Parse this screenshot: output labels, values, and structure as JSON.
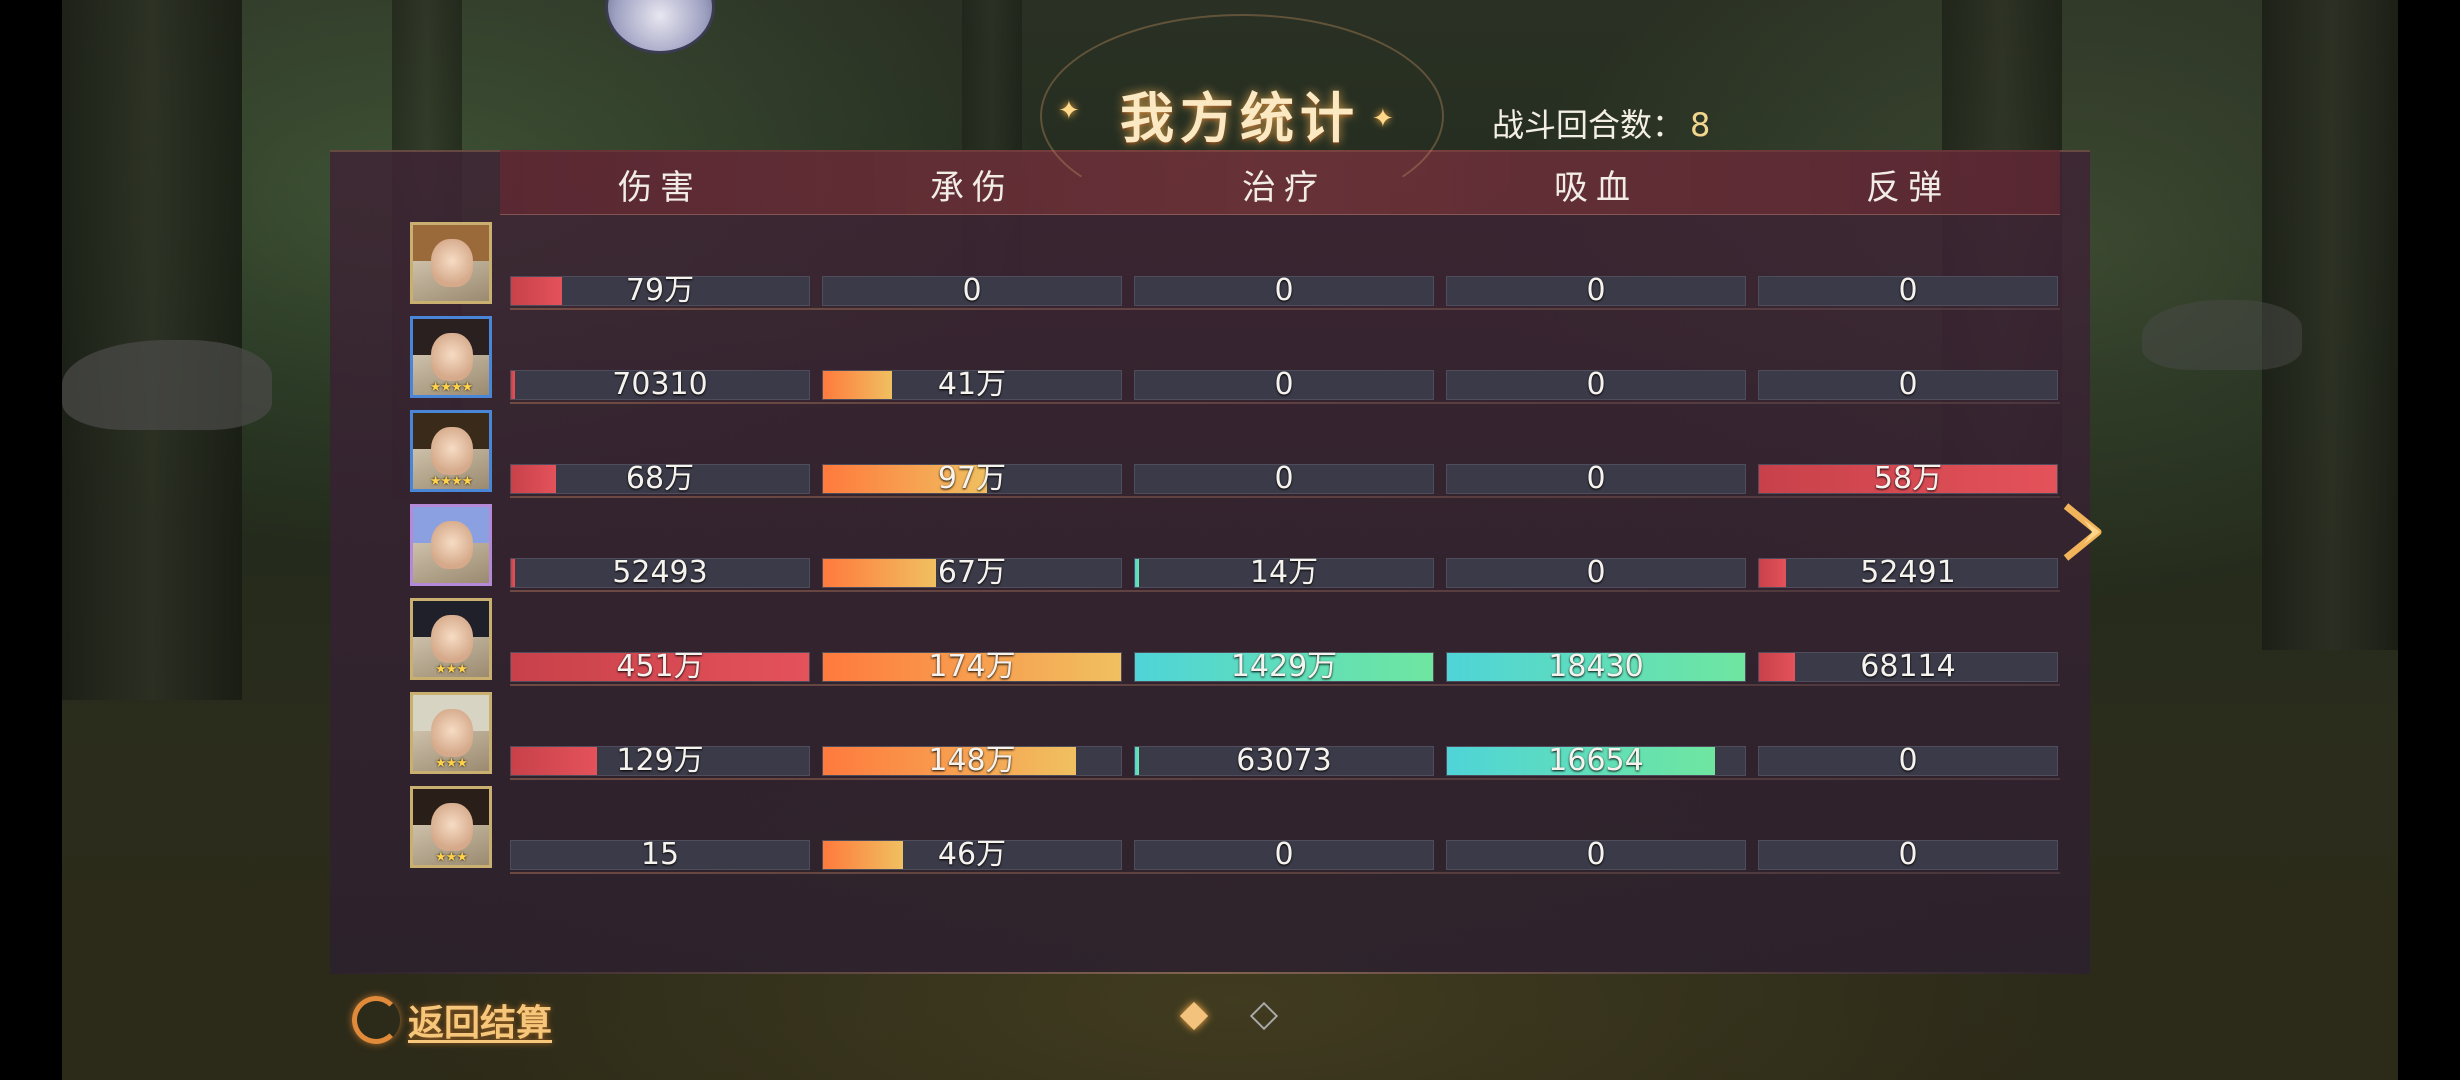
{
  "title": "我方统计",
  "rounds_label": "战斗回合数：",
  "rounds_value": "8",
  "columns": [
    "伤害",
    "承伤",
    "治疗",
    "吸血",
    "反弹"
  ],
  "bar_colors": {
    "damage": "#d4434c",
    "taken": "#ff8a3d",
    "heal": "#4fd4d8",
    "lifesteal": "#4fd4d8",
    "reflect": "#d4434c"
  },
  "rows": [
    {
      "hero": "hero-1",
      "stars": "",
      "frame": "#c9b070",
      "cells": [
        {
          "text": "79万",
          "fill": 0.17
        },
        {
          "text": "0",
          "fill": 0
        },
        {
          "text": "0",
          "fill": 0
        },
        {
          "text": "0",
          "fill": 0
        },
        {
          "text": "0",
          "fill": 0
        }
      ]
    },
    {
      "hero": "hero-2",
      "stars": "★★★★",
      "frame": "#4a86d8",
      "cells": [
        {
          "text": "70310",
          "fill": 0.015
        },
        {
          "text": "41万",
          "fill": 0.23
        },
        {
          "text": "0",
          "fill": 0
        },
        {
          "text": "0",
          "fill": 0
        },
        {
          "text": "0",
          "fill": 0
        }
      ]
    },
    {
      "hero": "hero-3",
      "stars": "★★★★",
      "frame": "#4a86d8",
      "cells": [
        {
          "text": "68万",
          "fill": 0.15
        },
        {
          "text": "97万",
          "fill": 0.55
        },
        {
          "text": "0",
          "fill": 0
        },
        {
          "text": "0",
          "fill": 0
        },
        {
          "text": "58万",
          "fill": 1.0
        }
      ]
    },
    {
      "hero": "hero-4",
      "stars": "",
      "frame": "#b48ad8",
      "cells": [
        {
          "text": "52493",
          "fill": 0.01
        },
        {
          "text": "67万",
          "fill": 0.38
        },
        {
          "text": "14万",
          "fill": 0.01
        },
        {
          "text": "0",
          "fill": 0
        },
        {
          "text": "52491",
          "fill": 0.09
        }
      ]
    },
    {
      "hero": "hero-5",
      "stars": "★★★",
      "frame": "#c9b070",
      "cells": [
        {
          "text": "451万",
          "fill": 1.0
        },
        {
          "text": "174万",
          "fill": 1.0
        },
        {
          "text": "1429万",
          "fill": 1.0
        },
        {
          "text": "18430",
          "fill": 1.0
        },
        {
          "text": "68114",
          "fill": 0.12
        }
      ]
    },
    {
      "hero": "hero-6",
      "stars": "★★★",
      "frame": "#c9b070",
      "cells": [
        {
          "text": "129万",
          "fill": 0.29
        },
        {
          "text": "148万",
          "fill": 0.85
        },
        {
          "text": "63073",
          "fill": 0.005
        },
        {
          "text": "16654",
          "fill": 0.9
        },
        {
          "text": "0",
          "fill": 0
        }
      ]
    },
    {
      "hero": "hero-7",
      "stars": "★★★",
      "frame": "#c9b070",
      "cells": [
        {
          "text": "15",
          "fill": 0
        },
        {
          "text": "46万",
          "fill": 0.27
        },
        {
          "text": "0",
          "fill": 0
        },
        {
          "text": "0",
          "fill": 0
        },
        {
          "text": "0",
          "fill": 0
        }
      ]
    }
  ],
  "back_label": "返回结算",
  "page_indicator": {
    "current": 1,
    "total": 2
  }
}
